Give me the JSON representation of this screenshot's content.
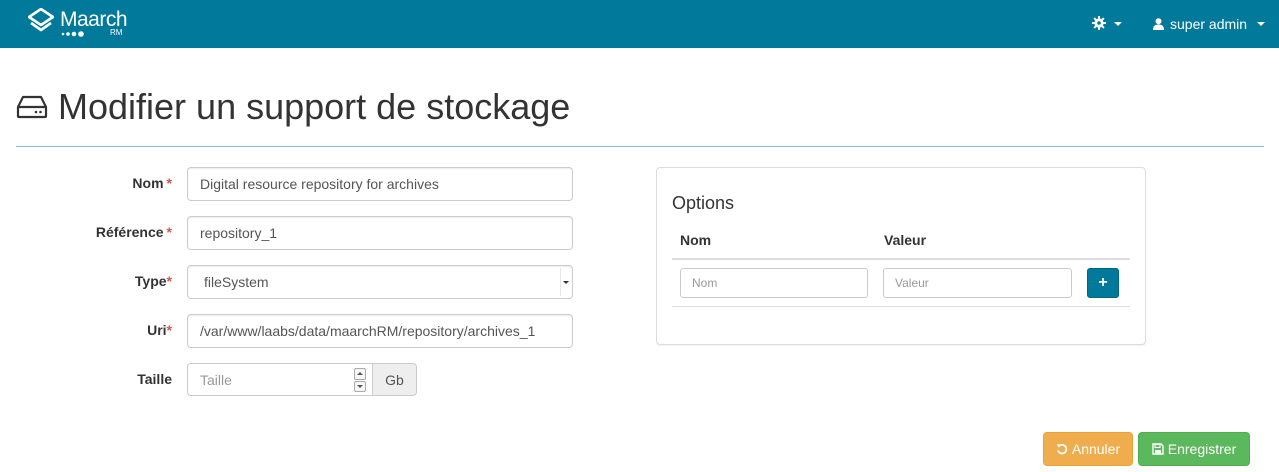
{
  "navbar": {
    "brand_name": "Maarch",
    "brand_sub": "RM",
    "user_name": "super admin",
    "icons": [
      "maarch-logo-icon",
      "gear-icon",
      "user-icon",
      "chevron-down-icon"
    ],
    "background_color": "#00799a"
  },
  "page": {
    "title": "Modifier un support de stockage",
    "title_icon": "hard-drive-icon"
  },
  "form": {
    "nom_label": "Nom",
    "nom_value": "Digital resource repository for archives",
    "reference_label": "Référence",
    "reference_value": "repository_1",
    "type_label": "Type",
    "type_value": "fileSystem",
    "uri_label": "Uri",
    "uri_value": "/var/www/laabs/data/maarchRM/repository/archives_1",
    "taille_label": "Taille",
    "taille_placeholder": "Taille",
    "taille_unit": "Gb",
    "required_marker": "*"
  },
  "options": {
    "title": "Options",
    "col_nom": "Nom",
    "col_valeur": "Valeur",
    "nom_placeholder": "Nom",
    "valeur_placeholder": "Valeur",
    "add_label": "+"
  },
  "actions": {
    "cancel_label": "Annuler",
    "save_label": "Enregistrer",
    "cancel_color": "#f0ad4e",
    "save_color": "#5cb85c"
  }
}
